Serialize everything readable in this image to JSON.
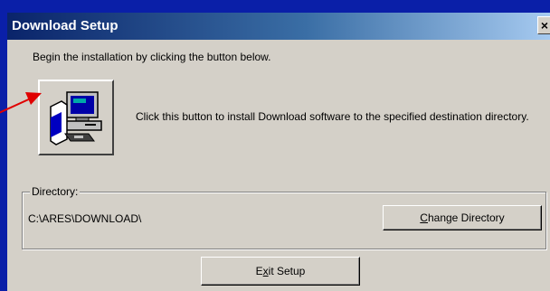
{
  "window": {
    "title": "Download Setup",
    "close_label": "×"
  },
  "intro_text": "Begin the installation by clicking the button below.",
  "install": {
    "description": "Click this button to install Download software to the specified destination directory."
  },
  "directory": {
    "legend": "Directory:",
    "path": "C:\\ARES\\DOWNLOAD\\",
    "change_button": {
      "prefix": "",
      "mnemonic": "C",
      "suffix": "hange Directory"
    }
  },
  "exit_button": {
    "prefix": "E",
    "mnemonic": "x",
    "suffix": "it Setup"
  },
  "colors": {
    "desktop": "#0a1fa8",
    "title_gradient_start": "#0a246a",
    "title_gradient_end": "#a6caf0",
    "face": "#d4d0c8",
    "arrow": "#e00000"
  },
  "icons": {
    "install": "computer-setup-icon",
    "close": "close-icon",
    "arrow": "red-arrow-icon"
  }
}
